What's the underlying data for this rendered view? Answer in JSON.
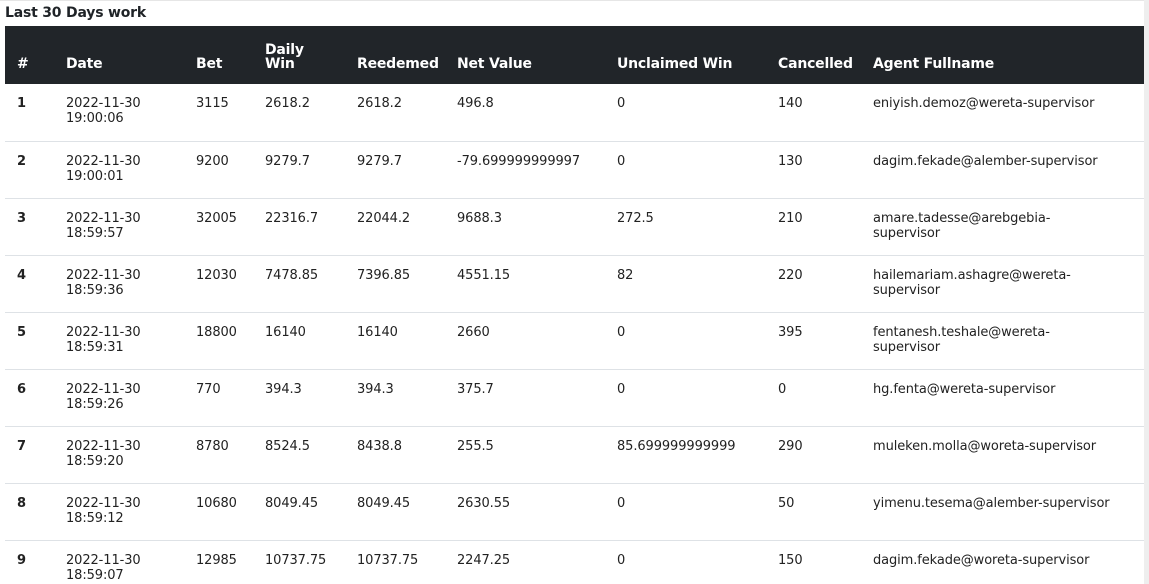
{
  "section": {
    "title": "Last 30 Days work"
  },
  "table": {
    "headers": {
      "index": "#",
      "date": "Date",
      "bet": "Bet",
      "daily_win_line1": "Daily",
      "daily_win_line2": "Win",
      "reedemed": "Reedemed",
      "net_value": "Net Value",
      "unclaimed_win": "Unclaimed Win",
      "cancelled": "Cancelled",
      "agent_fullname": "Agent Fullname"
    },
    "rows": [
      {
        "index": "1",
        "date": "2022-11-30",
        "time": "19:00:06",
        "bet": "3115",
        "daily_win": "2618.2",
        "reedemed": "2618.2",
        "net_value": "496.8",
        "unclaimed_win": "0",
        "cancelled": "140",
        "agent_line1": "eniyish.demoz@wereta-supervisor",
        "agent_line2": ""
      },
      {
        "index": "2",
        "date": "2022-11-30",
        "time": "19:00:01",
        "bet": "9200",
        "daily_win": "9279.7",
        "reedemed": "9279.7",
        "net_value": "-79.699999999997",
        "unclaimed_win": "0",
        "cancelled": "130",
        "agent_line1": "dagim.fekade@alember-supervisor",
        "agent_line2": ""
      },
      {
        "index": "3",
        "date": "2022-11-30",
        "time": "18:59:57",
        "bet": "32005",
        "daily_win": "22316.7",
        "reedemed": "22044.2",
        "net_value": "9688.3",
        "unclaimed_win": "272.5",
        "cancelled": "210",
        "agent_line1": "amare.tadesse@arebgebia-",
        "agent_line2": "supervisor"
      },
      {
        "index": "4",
        "date": "2022-11-30",
        "time": "18:59:36",
        "bet": "12030",
        "daily_win": "7478.85",
        "reedemed": "7396.85",
        "net_value": "4551.15",
        "unclaimed_win": "82",
        "cancelled": "220",
        "agent_line1": "hailemariam.ashagre@wereta-",
        "agent_line2": "supervisor"
      },
      {
        "index": "5",
        "date": "2022-11-30",
        "time": "18:59:31",
        "bet": "18800",
        "daily_win": "16140",
        "reedemed": "16140",
        "net_value": "2660",
        "unclaimed_win": "0",
        "cancelled": "395",
        "agent_line1": "fentanesh.teshale@wereta-",
        "agent_line2": "supervisor"
      },
      {
        "index": "6",
        "date": "2022-11-30",
        "time": "18:59:26",
        "bet": "770",
        "daily_win": "394.3",
        "reedemed": "394.3",
        "net_value": "375.7",
        "unclaimed_win": "0",
        "cancelled": "0",
        "agent_line1": "hg.fenta@wereta-supervisor",
        "agent_line2": ""
      },
      {
        "index": "7",
        "date": "2022-11-30",
        "time": "18:59:20",
        "bet": "8780",
        "daily_win": "8524.5",
        "reedemed": "8438.8",
        "net_value": "255.5",
        "unclaimed_win": "85.699999999999",
        "cancelled": "290",
        "agent_line1": "muleken.molla@woreta-supervisor",
        "agent_line2": ""
      },
      {
        "index": "8",
        "date": "2022-11-30",
        "time": "18:59:12",
        "bet": "10680",
        "daily_win": "8049.45",
        "reedemed": "8049.45",
        "net_value": "2630.55",
        "unclaimed_win": "0",
        "cancelled": "50",
        "agent_line1": "yimenu.tesema@alember-supervisor",
        "agent_line2": ""
      },
      {
        "index": "9",
        "date": "2022-11-30",
        "time": "18:59:07",
        "bet": "12985",
        "daily_win": "10737.75",
        "reedemed": "10737.75",
        "net_value": "2247.25",
        "unclaimed_win": "0",
        "cancelled": "150",
        "agent_line1": "dagim.fekade@woreta-supervisor",
        "agent_line2": ""
      }
    ]
  },
  "colors": {
    "header_background": "#212529",
    "header_text": "#ffffff",
    "row_divider": "#dee2e6"
  }
}
